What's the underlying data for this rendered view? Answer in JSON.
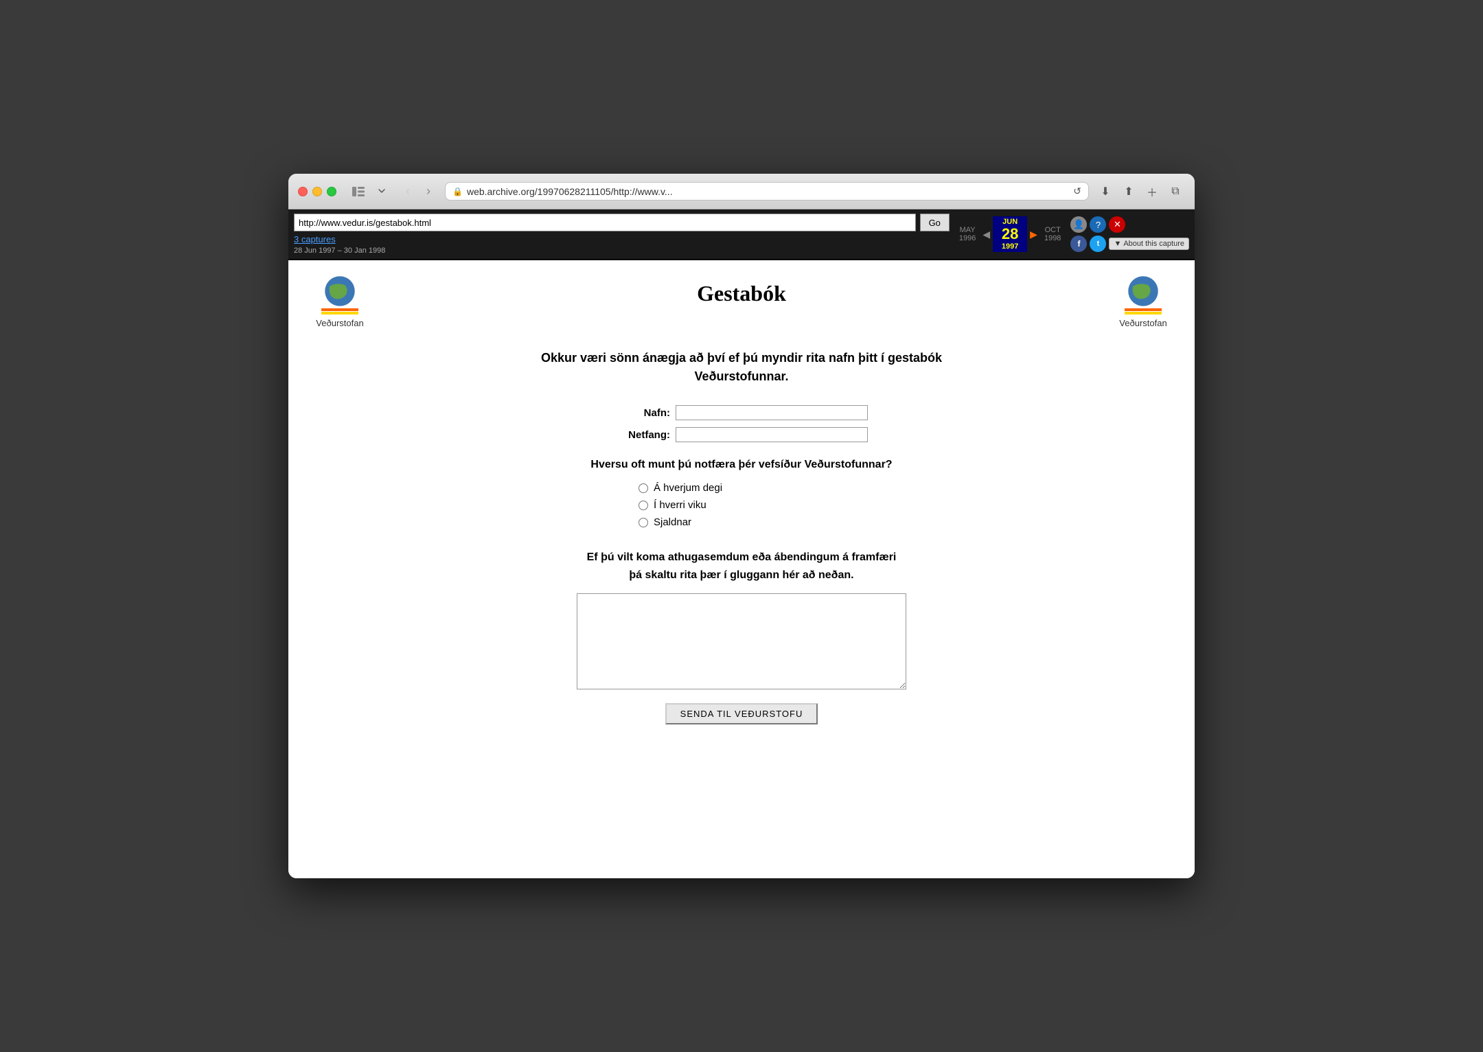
{
  "window": {
    "address": "web.archive.org/19970628211105/http://www.v..."
  },
  "wayback": {
    "url": "http://www.vedur.is/gestabok.html",
    "go_label": "Go",
    "captures_link": "3 captures",
    "date_range": "28 Jun 1997 – 30 Jan 1998",
    "prev_year": "1996",
    "active_month": "JUN",
    "active_day": "28",
    "active_year": "1997",
    "next_month": "OCT",
    "may_label": "MAY",
    "next_year": "1998",
    "about_capture": "About this capture"
  },
  "page": {
    "title": "Gestabók",
    "logo_left_label": "Veðurstofan",
    "logo_right_label": "Veðurstofan",
    "intro_text": "Okkur væri sönn ánægja að því ef þú myndir rita nafn þitt í gestabók Veðurstofunnar.",
    "name_label": "Nafn:",
    "email_label": "Netfang:",
    "frequency_question": "Hversu oft munt þú notfæra þér vefsíður Veðurstofunnar?",
    "radio_options": [
      "Á hverjum degi",
      "Í hverri viku",
      "Sjaldnar"
    ],
    "comment_text": "Ef þú vilt koma athugasemdum eða ábendingum á framfæri\nþá skaltu rita þær í gluggann hér að neðan.",
    "submit_label": "SENDA TIL VEÐURSTOFU"
  }
}
